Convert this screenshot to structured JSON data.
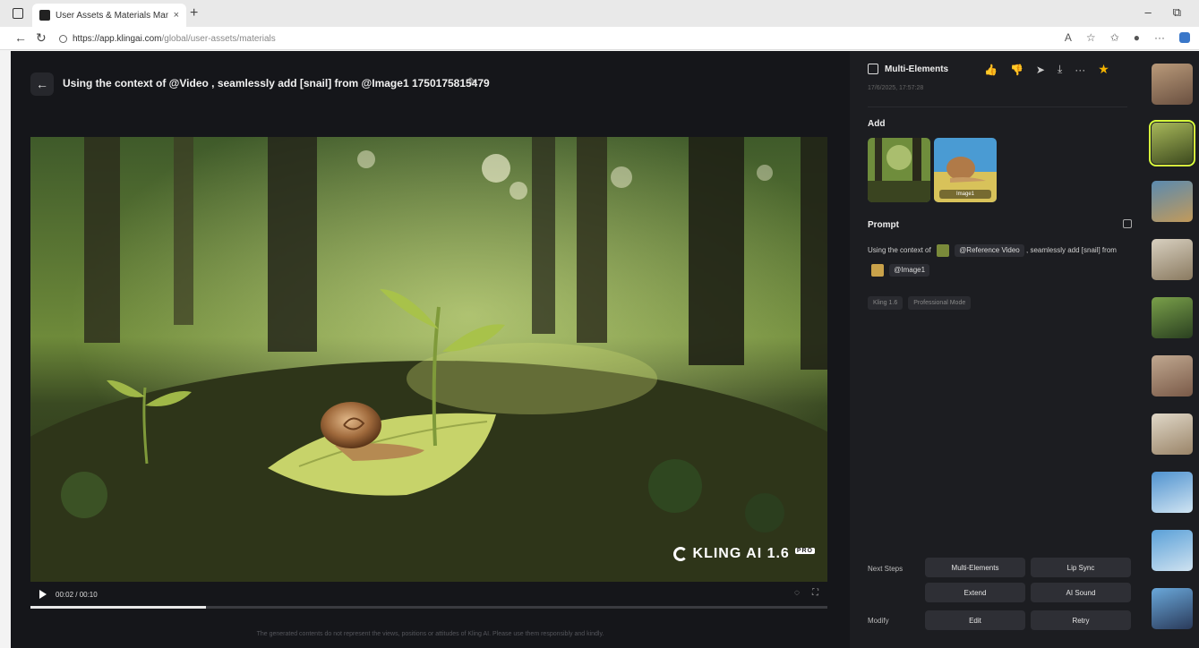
{
  "browser": {
    "tab_title": "User Assets & Materials Manage",
    "tab_close": "×",
    "new_tab": "+",
    "url_host": "https://app.klingai.com",
    "url_path": "/global/user-assets/materials",
    "win_min": "–",
    "win_max": "⧉"
  },
  "header": {
    "back": "←",
    "title": "Using the context of @Video , seamlessly add [snail] from @Image1 1750175815479",
    "edit": "✎"
  },
  "player": {
    "time": "00:02 / 00:10",
    "progress": 0.22,
    "watermark": "KLING AI 1.6",
    "watermark_badge": "PRO",
    "disclaimer": "The generated contents do not represent the views, positions or attitudes of Kling AI. Please use them responsibly and kindly."
  },
  "panel": {
    "title": "Multi-Elements",
    "date": "17/6/2025, 17:57:28",
    "add_label": "Add",
    "image1_label": "Image1",
    "prompt_label": "Prompt",
    "prompt_text_1": "Using the context of",
    "prompt_ref_video": "@Reference Video",
    "prompt_text_2": ", seamlessly add [snail] from",
    "prompt_ref_image": "@Image1",
    "tag_model": "Kling 1.6",
    "tag_mode": "Professional Mode",
    "next_steps_label": "Next Steps",
    "modify_label": "Modify",
    "btn_multi": "Multi-Elements",
    "btn_lip": "Lip Sync",
    "btn_extend": "Extend",
    "btn_sound": "AI Sound",
    "btn_edit": "Edit",
    "btn_retry": "Retry"
  },
  "icons": {
    "like": "👍",
    "dislike": "👎",
    "share": "➤",
    "download": "⤓",
    "more": "···",
    "favorite": "★"
  },
  "colors": {
    "app_bg": "#15161a",
    "panel_bg": "#1c1d21",
    "accent": "#d7ff3c",
    "star": "#f5b400"
  }
}
